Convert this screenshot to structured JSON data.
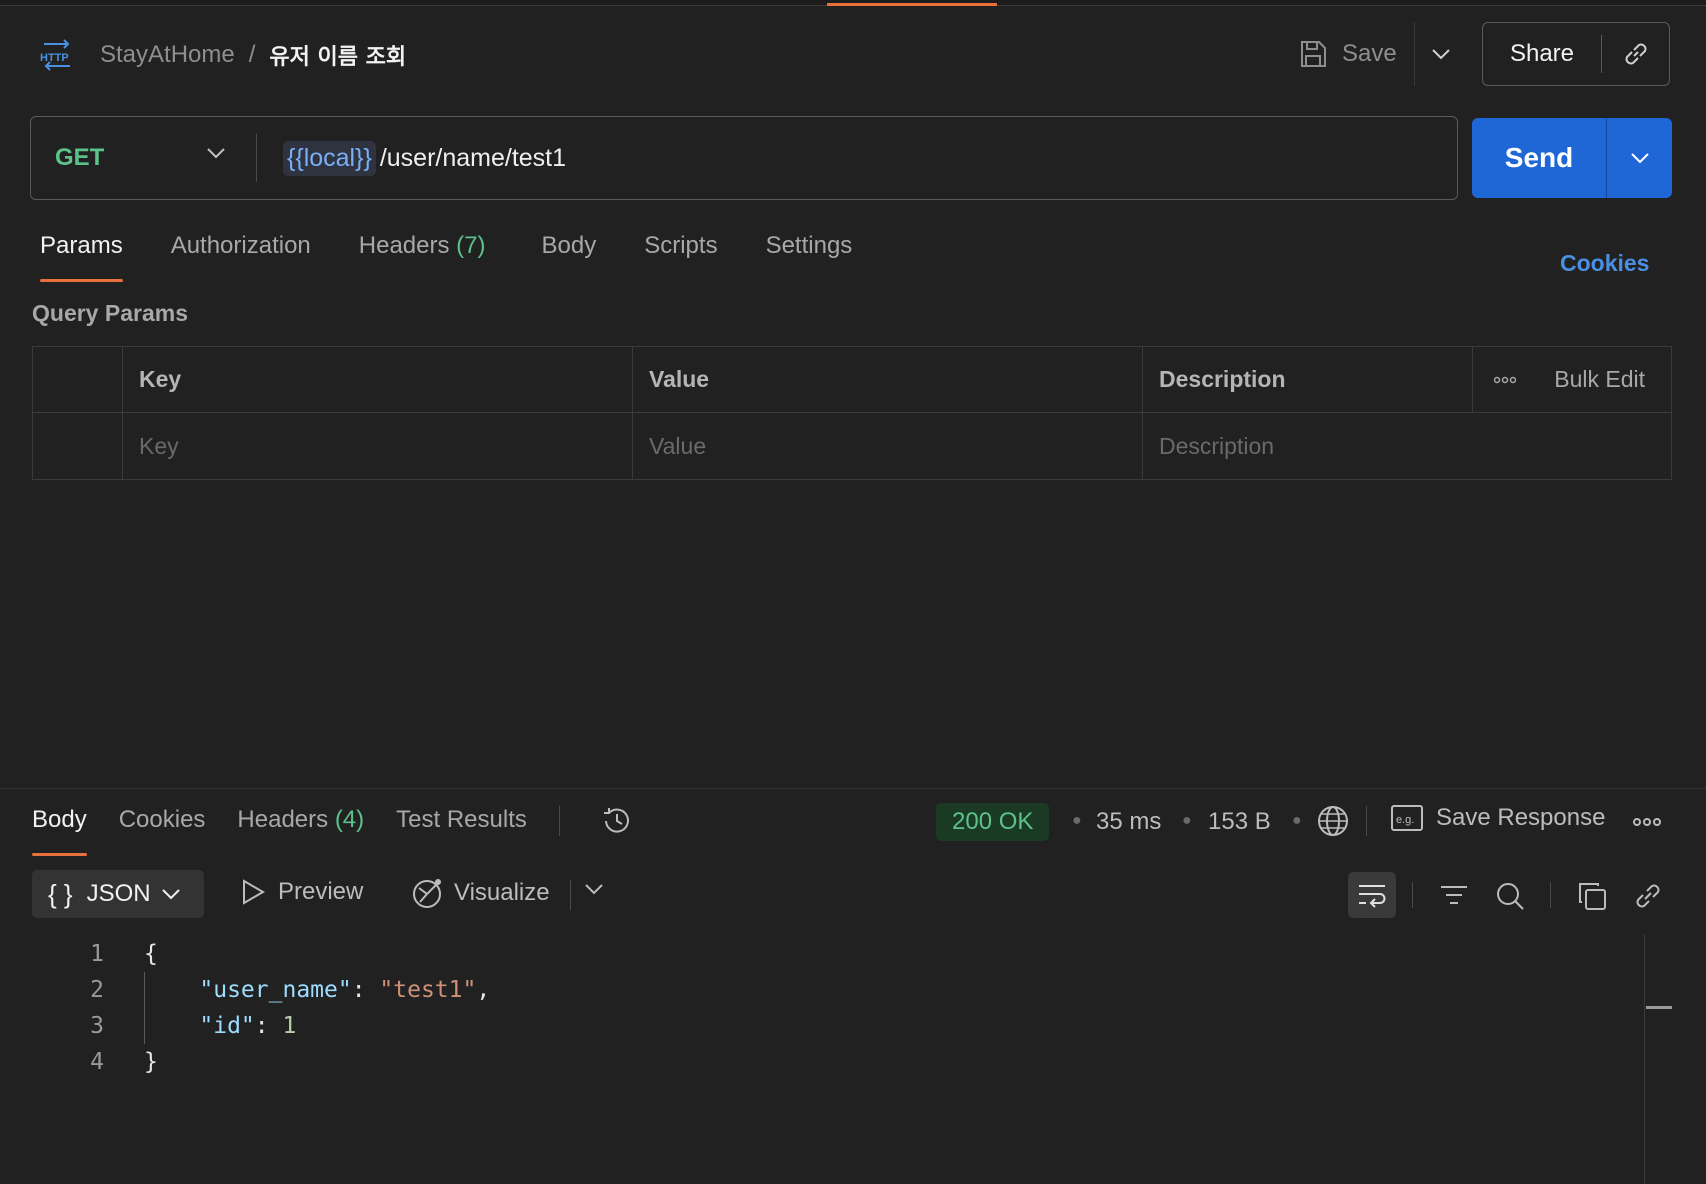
{
  "header": {
    "breadcrumb_parent": "StayAtHome",
    "breadcrumb_separator": "/",
    "request_name": "유저 이름 조회",
    "save_label": "Save",
    "share_label": "Share"
  },
  "request": {
    "method": "GET",
    "url_variable": "{{local}}",
    "url_path": "/user/name/test1",
    "send_label": "Send"
  },
  "request_tabs": {
    "params": "Params",
    "authorization": "Authorization",
    "headers": "Headers",
    "headers_count": "(7)",
    "body": "Body",
    "scripts": "Scripts",
    "settings": "Settings",
    "cookies": "Cookies"
  },
  "params": {
    "title": "Query Params",
    "col_key": "Key",
    "col_value": "Value",
    "col_description": "Description",
    "bulk_edit": "Bulk Edit",
    "placeholder_key": "Key",
    "placeholder_value": "Value",
    "placeholder_description": "Description"
  },
  "response": {
    "tabs": {
      "body": "Body",
      "cookies": "Cookies",
      "headers": "Headers",
      "headers_count": "(4)",
      "test_results": "Test Results"
    },
    "status": "200 OK",
    "time": "35 ms",
    "size": "153 B",
    "save_response": "Save Response",
    "format": "JSON",
    "preview": "Preview",
    "visualize": "Visualize"
  },
  "code": {
    "lines": [
      {
        "n": "1",
        "open": "{"
      },
      {
        "n": "2",
        "key": "\"user_name\"",
        "value": "\"test1\""
      },
      {
        "n": "3",
        "key": "\"id\"",
        "value": "1"
      },
      {
        "n": "4",
        "close": "}"
      }
    ]
  },
  "colors": {
    "accent_orange": "#e8703a",
    "send_blue": "#1f66d6",
    "method_green": "#5cc28a",
    "link_blue": "#4a90e2"
  }
}
